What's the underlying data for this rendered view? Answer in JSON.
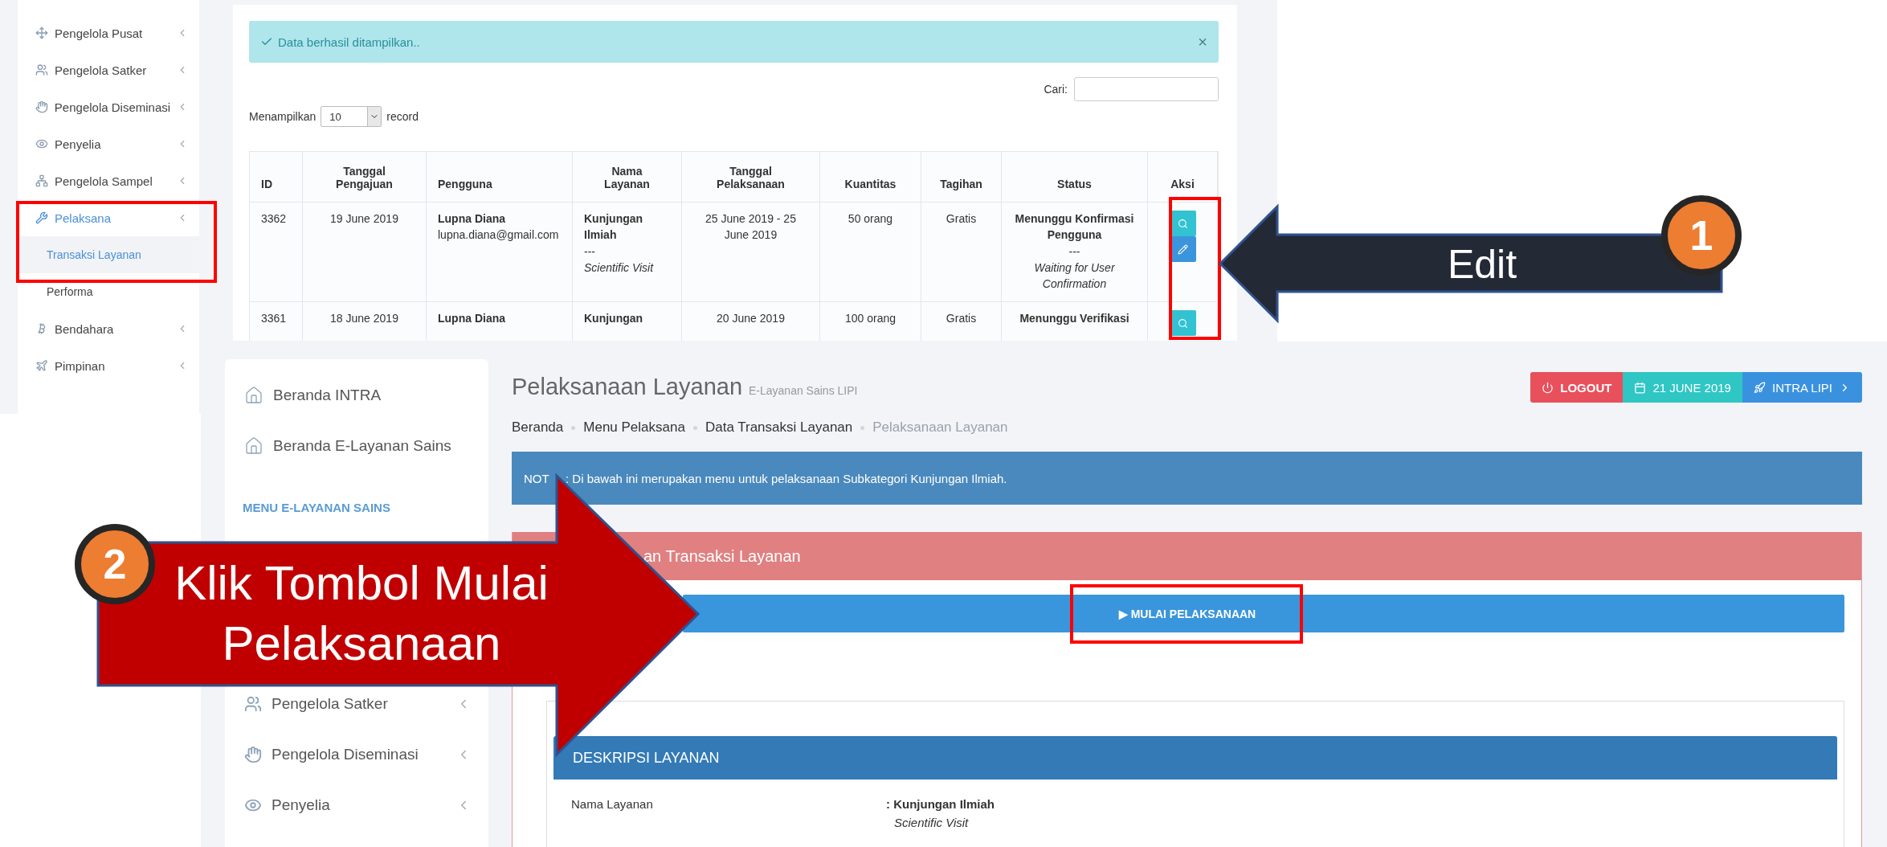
{
  "top_screenshot": {
    "sidebar": {
      "items": [
        {
          "label": "Pengelola Pusat",
          "selected": false
        },
        {
          "label": "Pengelola Satker",
          "selected": false
        },
        {
          "label": "Pengelola Diseminasi",
          "selected": false
        },
        {
          "label": "Penyelia",
          "selected": false
        },
        {
          "label": "Pengelola Sampel",
          "selected": false
        },
        {
          "label": "Pelaksana",
          "selected": true,
          "children": [
            {
              "label": "Transaksi Layanan",
              "selected": true
            },
            {
              "label": "Performa",
              "selected": false
            }
          ]
        },
        {
          "label": "Bendahara",
          "selected": false
        },
        {
          "label": "Pimpinan",
          "selected": false
        }
      ]
    },
    "alert": {
      "text": "Data berhasil ditampilkan..",
      "close": "×"
    },
    "search": {
      "label": "Cari:"
    },
    "length_menu": {
      "prefix": "Menampilkan",
      "value": "10",
      "suffix": "record"
    },
    "table": {
      "columns": [
        "ID",
        "Tanggal Pengajuan",
        "Pengguna",
        "Nama Layanan",
        "Tanggal Pelaksanaan",
        "Kuantitas",
        "Tagihan",
        "Status",
        "Aksi"
      ],
      "rows": [
        {
          "id": "3362",
          "submitted": "19 June 2019",
          "user_name": "Lupna Diana",
          "user_email": "lupna.diana@gmail.com",
          "service": "Kunjungan Ilmiah",
          "service_sep": "---",
          "service_en": "Scientific Visit",
          "date": "25 June 2019 - 25 June 2019",
          "quantity": "50 orang",
          "bill": "Gratis",
          "status": "Menunggu Konfirmasi Pengguna",
          "status_sep": "---",
          "status_en": "Waiting for User Confirmation",
          "actions": [
            {
              "kind": "view"
            },
            {
              "kind": "edit"
            }
          ]
        },
        {
          "id": "3361",
          "submitted": "18 June 2019",
          "user_name": "Lupna Diana",
          "service": "Kunjungan",
          "date": "20 June 2019",
          "quantity": "100 orang",
          "bill": "Gratis",
          "status": "Menunggu Verifikasi",
          "actions": [
            {
              "kind": "view"
            }
          ]
        }
      ]
    }
  },
  "bottom_screenshot": {
    "sidebar": {
      "items": [
        {
          "kind": "link",
          "label": "Beranda INTRA"
        },
        {
          "kind": "link",
          "label": "Beranda E-Layanan Sains"
        },
        {
          "kind": "heading",
          "label": "MENU E-LAYANAN SAINS"
        },
        {
          "kind": "menu",
          "label": "Pengelola Satker"
        },
        {
          "kind": "menu",
          "label": "Pengelola Diseminasi"
        },
        {
          "kind": "menu",
          "label": "Penyelia"
        }
      ]
    },
    "title": "Pelaksanaan Layanan",
    "subtitle": "E-Layanan Sains LIPI",
    "top_buttons": [
      {
        "kind": "logout",
        "label": "LOGOUT"
      },
      {
        "kind": "date",
        "label": "21 JUNE 2019"
      },
      {
        "kind": "link",
        "label": "INTRA LIPI"
      }
    ],
    "breadcrumb": [
      {
        "label": "Beranda",
        "current": false
      },
      {
        "label": "Menu Pelaksana",
        "current": false
      },
      {
        "label": "Data Transaksi Layanan",
        "current": false
      },
      {
        "label": "Pelaksanaan Layanan",
        "current": true
      }
    ],
    "note": {
      "lead": "NOT",
      "text": ": Di bawah ini merupakan menu untuk pelaksanaan Subkategori Kunjungan Ilmiah."
    },
    "panel": {
      "title": "an Transaksi Layanan",
      "start_button": "▶ MULAI PELAKSANAAN",
      "description": {
        "title": "DESKRIPSI LAYANAN",
        "rows": [
          {
            "label": "Nama Layanan",
            "value": ": Kunjungan Ilmiah",
            "note": "Scientific Visit"
          }
        ]
      }
    }
  },
  "annotations": [
    {
      "kind": "left",
      "step": "1",
      "label": "Edit"
    },
    {
      "kind": "right",
      "step": "2",
      "label": "Klik Tombol Mulai Pelaksanaan"
    }
  ]
}
